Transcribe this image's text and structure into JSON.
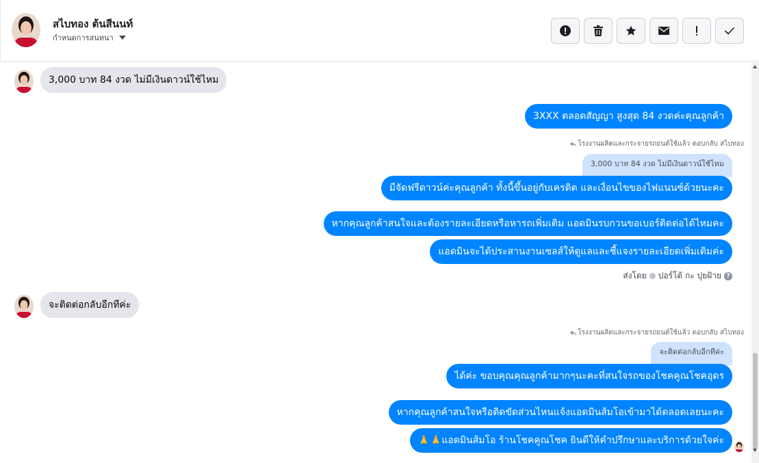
{
  "header": {
    "contact_name": "สไบทอง ต้นสีนนท์",
    "assign_label": "กำหนดการสนทนา",
    "actions": [
      {
        "name": "spam-button",
        "icon": "alert-circle-icon"
      },
      {
        "name": "delete-button",
        "icon": "trash-icon"
      },
      {
        "name": "star-button",
        "icon": "star-icon"
      },
      {
        "name": "mark-unread-button",
        "icon": "envelope-icon"
      },
      {
        "name": "follow-up-button",
        "icon": "exclamation-icon"
      },
      {
        "name": "done-button",
        "icon": "check-icon"
      }
    ]
  },
  "messages": {
    "m1": "3,000 บาท 84 งวด ไม่มีเงินดาวน์ใช้ไหม",
    "m2": "3XXX  ตลอดสัญญา สูงสุด 84 งวดค่ะคุณลูกค้า",
    "reply1_meta": "โรงงานผลิตและกระจายรถยนต์ใช้แล้ว ตอบกลับ สไบทอง",
    "reply1_quote": "3,000 บาท 84 งวด ไม่มีเงินดาวน์ใช้ไหม",
    "m3": "มีจัดฟรีดาวน์ค่ะคุณลูกค้า ทั้งนี้ขึ้นอยู่กับเครดิต และเงื่อนไขของไฟแนนซ์ด้วยนะคะ",
    "m4": "หากคุณลูกค้าสนใจและต้องรายละเอียดหรือหารถเพิ่มเติม แอดมินรบกวนขอเบอร์ติดต่อได้ไหมคะ",
    "m5": "แอดมินจะได้ประสานงานเซลส์ให้ดูแลและชี้แจงรายละเอียดเพิ่มเติมค่ะ",
    "sent_by_label": "ส่งโดย",
    "sent_by_name": "ปอร์โต้ กะ ปุยฝ้าย",
    "m6": "จะติดต่อกลับอีกทีค่ะ",
    "reply2_meta": "โรงงานผลิตและกระจายรถยนต์ใช้แล้ว ตอบกลับ สไบทอง",
    "reply2_quote": "จะติดต่อกลับอีกทีค่ะ",
    "m7": "ได้ค่ะ ขอบคุณคุณลูกค้ามากๆนะคะที่สนใจรถของโชคคูณโชคอุดร",
    "m8": "หากคุณลูกค้าสนใจหรือติดขัดส่วนไหนแจ้งแอดมินส้มโอเข้ามาได้ตลอดเลยนะคะ",
    "m9": "🙏🙏แอดมินส้มโอ ร้านโชคคูณโชค ยินดีให้คำปรึกษาและบริการด้วยใจค่ะ"
  },
  "colors": {
    "outgoing_bubble": "#0084ff",
    "incoming_bubble": "#e4e6eb",
    "quoted_bubble": "#cfe3ff"
  }
}
